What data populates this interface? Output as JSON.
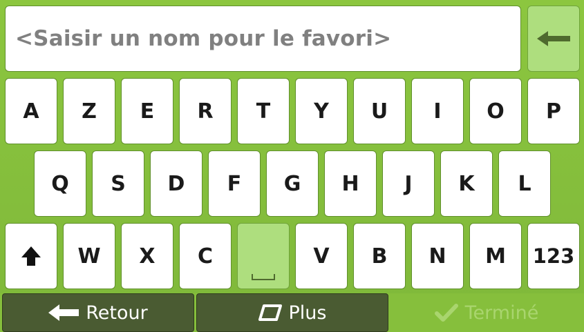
{
  "input": {
    "placeholder": "<Saisir un nom pour le favori>"
  },
  "keyboard": {
    "row1": [
      "A",
      "Z",
      "E",
      "R",
      "T",
      "Y",
      "U",
      "I",
      "O",
      "P"
    ],
    "row2": [
      "Q",
      "S",
      "D",
      "F",
      "G",
      "H",
      "J",
      "K",
      "L"
    ],
    "row3_letters": [
      "W",
      "X",
      "C",
      "V",
      "B",
      "N",
      "M"
    ],
    "numbers_label": "123",
    "shift_icon": "shift-arrow-icon",
    "space_icon": "space-bar-icon",
    "backspace_icon": "backspace-arrow-icon"
  },
  "bottom": {
    "back_label": "Retour",
    "back_icon": "left-arrow-icon",
    "more_label": "Plus",
    "more_icon": "rounded-square-icon",
    "done_label": "Terminé",
    "done_icon": "checkmark-icon"
  },
  "colors": {
    "background": "#86bf3c",
    "key": "#ffffff",
    "key_highlight": "#aede7e",
    "bottom_button": "#4a5b32",
    "placeholder_text": "#808080",
    "done_disabled": "#a9d56e"
  }
}
